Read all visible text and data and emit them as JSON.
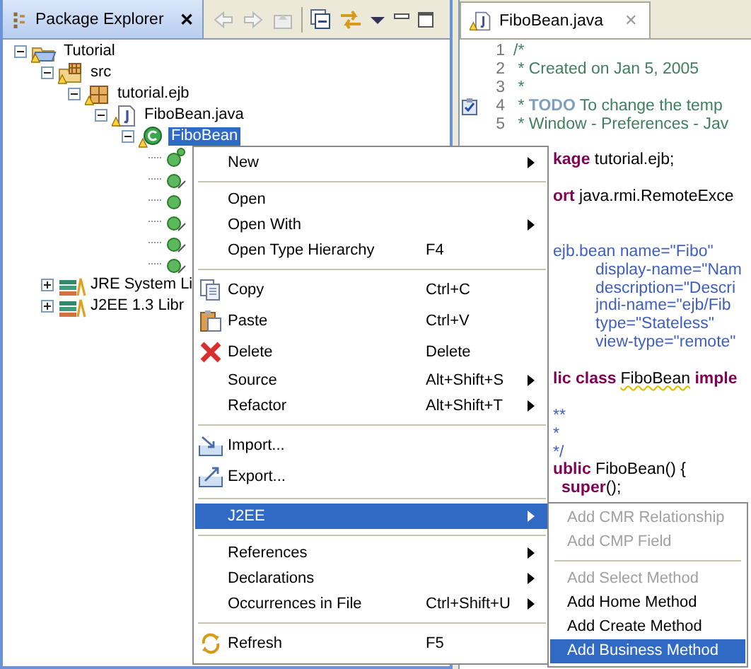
{
  "explorer": {
    "title": "Package Explorer",
    "close": "✕",
    "tree": [
      {
        "label": "Tutorial",
        "kind": "project",
        "expanded": true,
        "selected": false,
        "warning": true,
        "children": [
          {
            "label": "src",
            "kind": "source-folder",
            "expanded": true,
            "selected": false,
            "warning": true,
            "children": [
              {
                "label": "tutorial.ejb",
                "kind": "package",
                "expanded": true,
                "selected": false,
                "warning": true,
                "children": [
                  {
                    "label": "FiboBean.java",
                    "kind": "java-file",
                    "expanded": true,
                    "selected": false,
                    "warning": true,
                    "children": [
                      {
                        "label": "FiboBean",
                        "kind": "class",
                        "expanded": true,
                        "selected": true,
                        "warning": true,
                        "children": [
                          {
                            "kind": "constructor",
                            "selected": false
                          },
                          {
                            "kind": "method",
                            "selected": false
                          },
                          {
                            "kind": "field",
                            "selected": false
                          },
                          {
                            "kind": "method",
                            "selected": false
                          },
                          {
                            "kind": "method",
                            "selected": false
                          },
                          {
                            "kind": "method",
                            "selected": false
                          }
                        ]
                      }
                    ]
                  }
                ]
              }
            ]
          },
          {
            "label": "JRE System Li",
            "kind": "library",
            "expanded": false,
            "selected": false
          },
          {
            "label": "J2EE 1.3 Libr",
            "kind": "library",
            "expanded": false,
            "selected": false
          }
        ]
      }
    ]
  },
  "editor": {
    "tab": "FiboBean.java",
    "close": "✕",
    "lines": [
      {
        "number": "1",
        "segments": [
          {
            "text": "/*",
            "kind": "comment"
          }
        ]
      },
      {
        "number": "2",
        "segments": [
          {
            "text": " * Created on Jan 5, 2005",
            "kind": "comment"
          }
        ]
      },
      {
        "number": "3",
        "segments": [
          {
            "text": " *",
            "kind": "comment"
          }
        ]
      },
      {
        "number": "4",
        "task": true,
        "segments": [
          {
            "text": " * ",
            "kind": "comment"
          },
          {
            "text": "TODO",
            "kind": "todo"
          },
          {
            "text": " To change the temp",
            "kind": "comment"
          }
        ]
      },
      {
        "number": "5",
        "segments": [
          {
            "text": " * Window - Preferences - Jav",
            "kind": "comment"
          }
        ]
      },
      {
        "kind": "blank"
      },
      {
        "kind": "code",
        "segments": [
          {
            "text": "kage",
            "kind": "keyword"
          },
          {
            "text": " tutorial.ejb;",
            "kind": "plain"
          }
        ]
      },
      {
        "kind": "blank"
      },
      {
        "kind": "code",
        "segments": [
          {
            "text": "ort",
            "kind": "keyword"
          },
          {
            "text": " java.rmi.RemoteExce",
            "kind": "plain"
          }
        ]
      },
      {
        "kind": "blank"
      },
      {
        "kind": "blank"
      },
      {
        "kind": "code",
        "segments": [
          {
            "text": "ejb.bean name=\"Fibo\"",
            "kind": "javadoc"
          }
        ]
      },
      {
        "kind": "attr",
        "segments": [
          {
            "text": "display-name=\"Nam",
            "kind": "javadoc"
          }
        ]
      },
      {
        "kind": "attr",
        "segments": [
          {
            "text": "description=\"Descri",
            "kind": "javadoc"
          }
        ]
      },
      {
        "kind": "attr",
        "segments": [
          {
            "text": "jndi-name=\"ejb/Fib",
            "kind": "javadoc"
          }
        ]
      },
      {
        "kind": "attr",
        "segments": [
          {
            "text": "type=\"Stateless\"",
            "kind": "javadoc"
          }
        ]
      },
      {
        "kind": "attr",
        "segments": [
          {
            "text": "view-type=\"remote\"",
            "kind": "javadoc"
          }
        ]
      },
      {
        "kind": "blank"
      },
      {
        "kind": "code",
        "segments": [
          {
            "text": "lic class",
            "kind": "keyword"
          },
          {
            "text": "FiboBean",
            "kind": "warning"
          },
          {
            "text": " imple",
            "kind": "keyword"
          }
        ]
      },
      {
        "kind": "blank"
      },
      {
        "kind": "code",
        "segments": [
          {
            "text": "**",
            "kind": "javadoc"
          }
        ]
      },
      {
        "kind": "code",
        "segments": [
          {
            "text": "*",
            "kind": "javadoc"
          }
        ]
      },
      {
        "kind": "code",
        "segments": [
          {
            "text": "*/",
            "kind": "javadoc"
          }
        ]
      },
      {
        "kind": "code",
        "segments": [
          {
            "text": "ublic",
            "kind": "keyword"
          },
          {
            "text": " FiboBean() {",
            "kind": "plain"
          }
        ]
      },
      {
        "kind": "body",
        "segments": [
          {
            "text": "super",
            "kind": "keyword"
          },
          {
            "text": "();",
            "kind": "plain"
          }
        ]
      }
    ]
  },
  "menu": {
    "items": [
      {
        "kind": "item",
        "label": "New",
        "submenu": true,
        "selected": false
      },
      {
        "kind": "separator"
      },
      {
        "kind": "item",
        "label": "Open",
        "submenu": false,
        "selected": false
      },
      {
        "kind": "item",
        "label": "Open With",
        "submenu": true,
        "selected": false
      },
      {
        "kind": "item",
        "label": "Open Type Hierarchy",
        "shortcut": "F4",
        "submenu": false,
        "selected": false
      },
      {
        "kind": "separator"
      },
      {
        "kind": "item",
        "label": "Copy",
        "shortcut": "Ctrl+C",
        "submenu": false,
        "selected": false
      },
      {
        "kind": "item",
        "label": "Paste",
        "shortcut": "Ctrl+V",
        "submenu": false,
        "selected": false
      },
      {
        "kind": "item",
        "label": "Delete",
        "shortcut": "Delete",
        "submenu": false,
        "selected": false
      },
      {
        "kind": "item",
        "label": "Source",
        "shortcut": "Alt+Shift+S",
        "submenu": true,
        "selected": false
      },
      {
        "kind": "item",
        "label": "Refactor",
        "shortcut": "Alt+Shift+T",
        "submenu": true,
        "selected": false
      },
      {
        "kind": "separator"
      },
      {
        "kind": "item",
        "label": "Import...",
        "submenu": false,
        "selected": false
      },
      {
        "kind": "item",
        "label": "Export...",
        "submenu": false,
        "selected": false
      },
      {
        "kind": "separator"
      },
      {
        "kind": "item",
        "label": "J2EE",
        "submenu": true,
        "selected": true
      },
      {
        "kind": "separator"
      },
      {
        "kind": "item",
        "label": "References",
        "submenu": true,
        "selected": false
      },
      {
        "kind": "item",
        "label": "Declarations",
        "submenu": true,
        "selected": false
      },
      {
        "kind": "item",
        "label": "Occurrences in File",
        "shortcut": "Ctrl+Shift+U",
        "submenu": true,
        "selected": false
      },
      {
        "kind": "separator"
      },
      {
        "kind": "item",
        "label": "Refresh",
        "shortcut": "F5",
        "submenu": false,
        "selected": false
      }
    ]
  },
  "submenu": {
    "items": [
      {
        "kind": "item",
        "label": "Add CMR Relationship",
        "disabled": true,
        "selected": false
      },
      {
        "kind": "item",
        "label": "Add CMP Field",
        "disabled": true,
        "selected": false
      },
      {
        "kind": "separator"
      },
      {
        "kind": "item",
        "label": "Add Select Method",
        "disabled": true,
        "selected": false
      },
      {
        "kind": "item",
        "label": "Add Home Method",
        "disabled": false,
        "selected": false
      },
      {
        "kind": "item",
        "label": "Add Create Method",
        "disabled": false,
        "selected": false
      },
      {
        "kind": "item",
        "label": "Add Business Method",
        "disabled": false,
        "selected": true
      }
    ]
  }
}
